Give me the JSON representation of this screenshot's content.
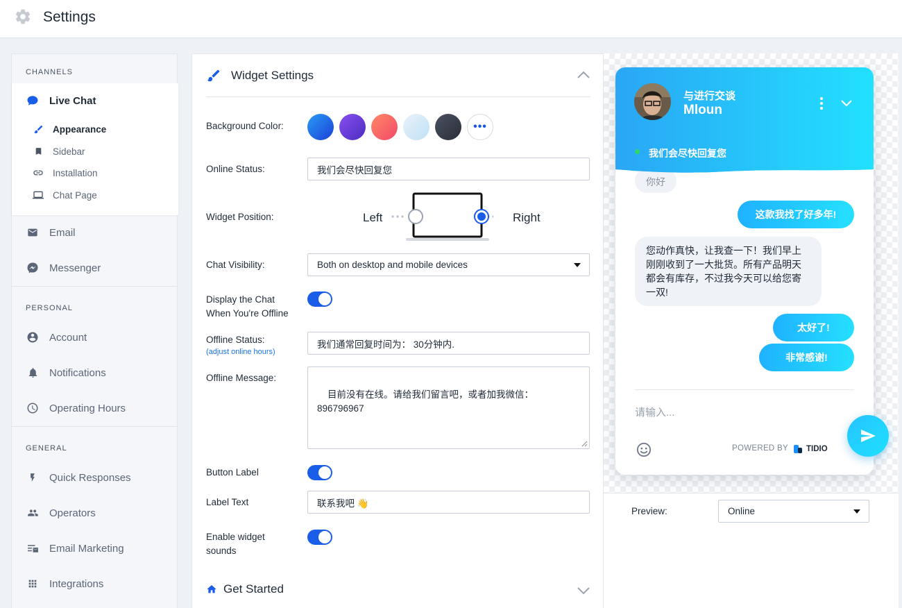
{
  "header": {
    "title": "Settings",
    "icon": "gear-icon"
  },
  "sidebar": {
    "sections": {
      "channels": "CHANNELS",
      "personal": "PERSONAL",
      "general": "GENERAL"
    },
    "live_chat": {
      "label": "Live Chat",
      "sub_items": [
        {
          "label": "Appearance",
          "icon": "brush-icon"
        },
        {
          "label": "Sidebar",
          "icon": "bookmark-icon"
        },
        {
          "label": "Installation",
          "icon": "link-icon"
        },
        {
          "label": "Chat Page",
          "icon": "laptop-icon"
        }
      ]
    },
    "channels": [
      {
        "label": "Email",
        "icon": "envelope-icon"
      },
      {
        "label": "Messenger",
        "icon": "messenger-icon"
      }
    ],
    "personal": [
      {
        "label": "Account",
        "icon": "account-icon"
      },
      {
        "label": "Notifications",
        "icon": "bell-icon"
      },
      {
        "label": "Operating Hours",
        "icon": "clock-icon"
      }
    ],
    "general": [
      {
        "label": "Quick Responses",
        "icon": "bolt-icon"
      },
      {
        "label": "Operators",
        "icon": "people-icon"
      },
      {
        "label": "Email Marketing",
        "icon": "email-marketing-icon"
      },
      {
        "label": "Integrations",
        "icon": "grid-icon"
      }
    ]
  },
  "widget_settings": {
    "title": "Widget Settings",
    "background_color": {
      "label": "Background Color:",
      "swatches": [
        "#1a6cf0",
        "#6a3fd9",
        "#f25e5e",
        "#cfe6f6",
        "#3b4150"
      ],
      "more": "•••"
    },
    "online_status": {
      "label": "Online Status:",
      "value": "我们会尽快回复您"
    },
    "widget_position": {
      "label": "Widget Position:",
      "left": "Left",
      "right": "Right",
      "selected": "Right"
    },
    "chat_visibility": {
      "label": "Chat Visibility:",
      "value": "Both on desktop and mobile devices"
    },
    "display_offline": {
      "label": "Display the Chat When You're Offline",
      "enabled": true
    },
    "offline_status": {
      "label": "Offline Status:",
      "link": "(adjust online hours)",
      "value": "我们通常回复时间为： 30分钟内."
    },
    "offline_message": {
      "label": "Offline Message:",
      "value": "目前没有在线。请给我们留言吧，或者加我微信：\n896796967"
    },
    "button_label": {
      "label": "Button Label",
      "enabled": true
    },
    "label_text": {
      "label": "Label Text",
      "value": "联系我吧 👋"
    },
    "widget_sounds": {
      "label": "Enable widget sounds",
      "enabled": true
    },
    "get_started": "Get Started"
  },
  "chat_widget": {
    "name_line1": "与进行交谈",
    "name_line2": "Mloun",
    "status": "我们会尽快回复您",
    "messages": [
      {
        "from": "operator",
        "text": "你好"
      },
      {
        "from": "visitor",
        "text": "这款我找了好多年!"
      },
      {
        "from": "operator",
        "text": "您动作真快，让我查一下！我们早上刚刚收到了一大批货。所有产品明天都会有库存，不过我今天可以给您寄一双!"
      },
      {
        "from": "visitor",
        "text": "太好了!"
      },
      {
        "from": "visitor",
        "text": "非常感谢!"
      }
    ],
    "input_placeholder": "请输入...",
    "powered_by": "POWERED BY",
    "brand": "TIDIO"
  },
  "preview": {
    "label": "Preview:",
    "value": "Online"
  }
}
